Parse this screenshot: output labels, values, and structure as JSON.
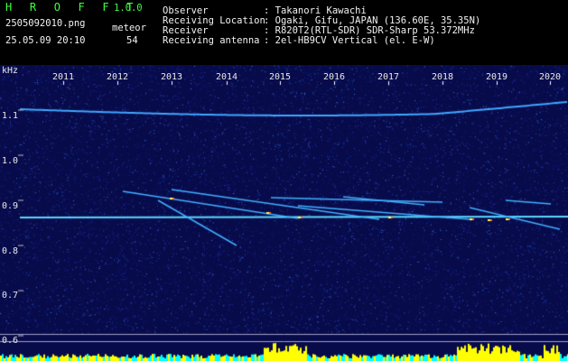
{
  "app": {
    "title": "H R O F F T",
    "version": "1.0.0"
  },
  "file": {
    "name": "2505092010.png",
    "datetime": "25.05.09 20:10"
  },
  "meteor": {
    "label": "meteor",
    "count": "54"
  },
  "info": {
    "labels": [
      "Observer",
      "Receiving Location",
      "Receiver",
      "Receiving antenna"
    ],
    "values": [
      ": Takanori Kawachi",
      ": Ogaki, Gifu, JAPAN (136.60E, 35.35N)",
      ": R820T2(RTL-SDR) SDR-Sharp 53.372MHz",
      ": 2el-HB9CV Vertical (el. E-W)"
    ]
  },
  "axis": {
    "unit": "kHz",
    "y_ticks": [
      "1.1",
      "1.0",
      "0.9",
      "0.8",
      "0.7",
      "0.6"
    ],
    "x_ticks": [
      "2011",
      "2012",
      "2013",
      "2014",
      "2015",
      "2016",
      "2017",
      "2018",
      "2019",
      "2020"
    ]
  },
  "colors": {
    "background": "#000000",
    "spectrum": "#0a0e55",
    "signal": "#4fc8ff",
    "meteor": "#ffff55",
    "bar": "#ffff00",
    "label": "#40ff40"
  }
}
